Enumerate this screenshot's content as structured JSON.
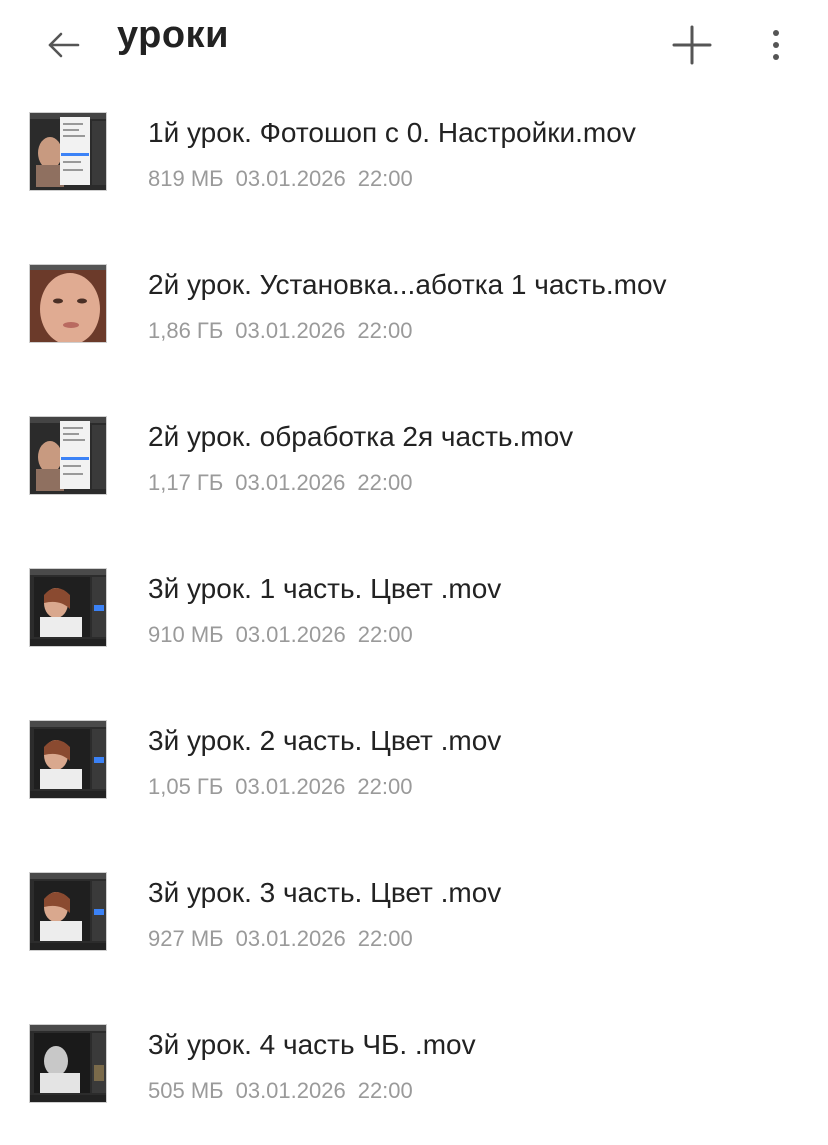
{
  "header": {
    "title": "уроки",
    "back_icon": "arrow-left-icon",
    "add_icon": "plus-icon",
    "more_icon": "more-vertical-icon"
  },
  "colors": {
    "title": "#222222",
    "file_name": "#222222",
    "meta": "#9a9a9a",
    "icon": "#555555",
    "background": "#ffffff"
  },
  "files": [
    {
      "name": "1й урок. Фотошоп с 0. Настройки.mov",
      "size": "819 МБ",
      "date": "03.01.2026",
      "time": "22:00",
      "thumb": "photoshop-menu"
    },
    {
      "name": "2й урок. Установка...аботка 1 часть.mov",
      "size": "1,86 ГБ",
      "date": "03.01.2026",
      "time": "22:00",
      "thumb": "face-closeup"
    },
    {
      "name": "2й урок. обработка 2я часть.mov",
      "size": "1,17 ГБ",
      "date": "03.01.2026",
      "time": "22:00",
      "thumb": "photoshop-menu"
    },
    {
      "name": "3й урок. 1 часть. Цвет .mov",
      "size": "910 МБ",
      "date": "03.01.2026",
      "time": "22:00",
      "thumb": "portrait-editor"
    },
    {
      "name": "3й урок. 2 часть. Цвет .mov",
      "size": "1,05 ГБ",
      "date": "03.01.2026",
      "time": "22:00",
      "thumb": "portrait-editor"
    },
    {
      "name": "3й урок. 3 часть. Цвет .mov",
      "size": "927 МБ",
      "date": "03.01.2026",
      "time": "22:00",
      "thumb": "portrait-editor"
    },
    {
      "name": "3й урок. 4 часть ЧБ. .mov",
      "size": "505 МБ",
      "date": "03.01.2026",
      "time": "22:00",
      "thumb": "bw-portrait-editor"
    }
  ]
}
